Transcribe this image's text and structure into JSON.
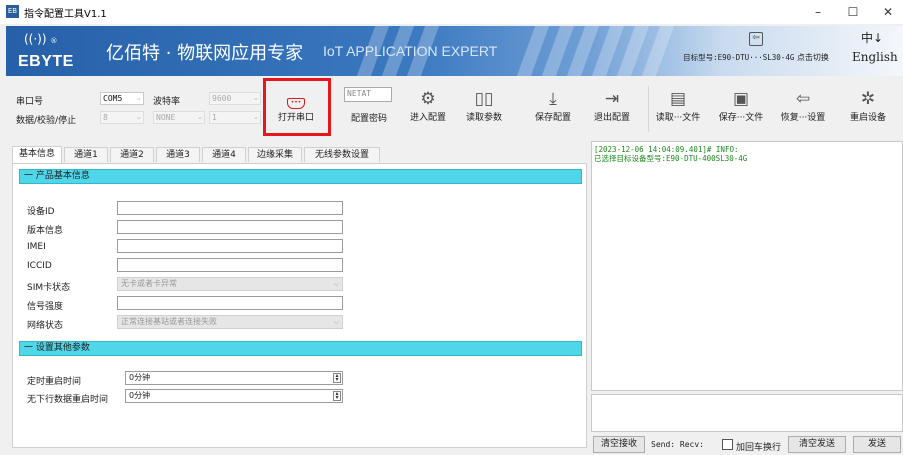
{
  "window": {
    "title": "指令配置工具V1.1",
    "icon_text": "EB",
    "min": "–",
    "max": "☐",
    "close": "✕"
  },
  "banner": {
    "logo": "EBYTE",
    "wave": "((·))",
    "reg": "®",
    "title_cn": "亿佰特 · 物联网应用专家",
    "title_en": "IoT APPLICATION EXPERT",
    "model_label": "目标型号:E90-DTU···SL30-4G",
    "switch_label": "点击切换",
    "lang_icon": "中↓",
    "lang_label": "English"
  },
  "toolbar": {
    "port_label": "串口号",
    "port_value": "COM5",
    "baud_label": "波特率",
    "baud_value": "9600",
    "data_label": "数据/校验/停止",
    "data_bits": "8",
    "parity": "NONE",
    "stop_bits": "1",
    "open_port": "打开串口",
    "password_value": "NETAT",
    "password_label": "配置密码",
    "enter_config": "进入配置",
    "read_params": "读取参数",
    "save_config": "保存配置",
    "exit_config": "退出配置",
    "read_file": "读取···文件",
    "save_file": "保存···文件",
    "restore_settings": "恢复···设置",
    "restart_device": "重启设备"
  },
  "tabs": [
    "基本信息",
    "通道1",
    "通道2",
    "通道3",
    "通道4",
    "边缘采集",
    "无线参数设置"
  ],
  "basic": {
    "section1": "一 产品基本信息",
    "fields": [
      {
        "label": "设备ID",
        "value": ""
      },
      {
        "label": "版本信息",
        "value": ""
      },
      {
        "label": "IMEI",
        "value": ""
      },
      {
        "label": "ICCID",
        "value": ""
      }
    ],
    "sim_label": "SIM卡状态",
    "sim_value": "无卡或者卡异常",
    "signal_label": "信号强度",
    "net_label": "网络状态",
    "net_value": "正常连接基站或者连接失败",
    "section2": "一 设置其他参数",
    "timer_label": "定时重启时间",
    "timer_value": "0分钟",
    "nodata_label": "无下行数据重启时间",
    "nodata_value": "0分钟"
  },
  "log": {
    "line1": "[2023-12-06 14:04:09.401]# INFO:",
    "line2": "已选择目标设备型号:E90-DTU-400SL30-4G"
  },
  "bottom": {
    "clear_recv": "清空接收",
    "send_recv": "Send:  Recv:",
    "add_newline": "加回车换行",
    "clear_send": "清空发送",
    "send": "发送"
  },
  "colors": {
    "section_bg": "#4fd6e8",
    "highlight": "#e5161c",
    "log_text": "#1b8a1b"
  }
}
